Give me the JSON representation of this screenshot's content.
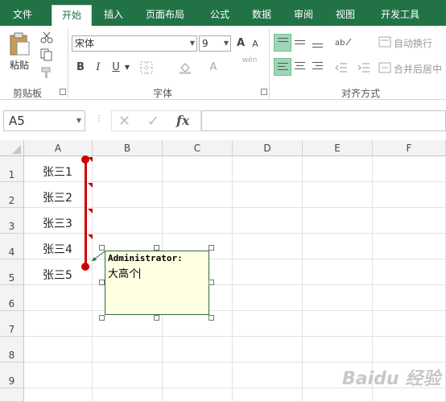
{
  "tabs": [
    {
      "label": "文件",
      "active": false
    },
    {
      "label": "开始",
      "active": true
    },
    {
      "label": "插入",
      "active": false
    },
    {
      "label": "页面布局",
      "active": false
    },
    {
      "label": "公式",
      "active": false
    },
    {
      "label": "数据",
      "active": false
    },
    {
      "label": "审阅",
      "active": false
    },
    {
      "label": "视图",
      "active": false
    },
    {
      "label": "开发工具",
      "active": false
    }
  ],
  "ribbon": {
    "clipboard": {
      "paste_label": "粘贴",
      "group_label": "剪贴板"
    },
    "font": {
      "font_name": "宋体",
      "font_size": "9",
      "group_label": "字体",
      "bold": "B",
      "italic": "I",
      "underline": "U",
      "grow": "A",
      "shrink": "A",
      "font_color": "A",
      "phonetic": "wén"
    },
    "alignment": {
      "wrap_text": "自动换行",
      "merge_center": "合并后居中",
      "group_label": "对齐方式"
    }
  },
  "formula_bar": {
    "name_box": "A5",
    "fx": "fx",
    "formula": ""
  },
  "grid": {
    "columns": [
      "A",
      "B",
      "C",
      "D",
      "E",
      "F"
    ],
    "rows": [
      "1",
      "2",
      "3",
      "4",
      "5",
      "6",
      "7",
      "8",
      "9"
    ],
    "cells": [
      {
        "ref": "A1",
        "value": "张三1"
      },
      {
        "ref": "A2",
        "value": "张三2"
      },
      {
        "ref": "A3",
        "value": "张三3"
      },
      {
        "ref": "A4",
        "value": "张三4"
      },
      {
        "ref": "A5",
        "value": "张三5"
      }
    ]
  },
  "comment": {
    "author": "Administrator:",
    "text": "大高个"
  },
  "watermark": "Baidu 经验",
  "colors": {
    "excel_green": "#217346",
    "comment_bg": "#ffffe1",
    "indicator_red": "#c00000",
    "annotation_red": "#d00000"
  }
}
